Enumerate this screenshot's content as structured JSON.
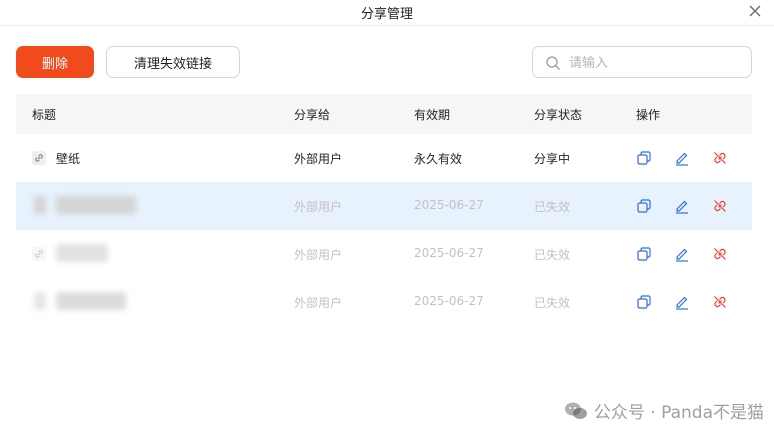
{
  "dialog": {
    "title": "分享管理"
  },
  "toolbar": {
    "delete_label": "删除",
    "clean_label": "清理失效链接"
  },
  "search": {
    "placeholder": "请输入"
  },
  "columns": [
    "标题",
    "分享给",
    "有效期",
    "分享状态",
    "操作"
  ],
  "rows": [
    {
      "title": "壁纸",
      "share_to": "外部用户",
      "expiry": "永久有效",
      "status": "分享中",
      "state": "active",
      "selected": false
    },
    {
      "title": "",
      "share_to": "外部用户",
      "expiry": "2025-06-27",
      "status": "已失效",
      "state": "expired",
      "selected": true
    },
    {
      "title": "",
      "share_to": "外部用户",
      "expiry": "2025-06-27",
      "status": "已失效",
      "state": "expired",
      "selected": false
    },
    {
      "title": "",
      "share_to": "外部用户",
      "expiry": "2025-06-27",
      "status": "已失效",
      "state": "expired",
      "selected": false
    }
  ],
  "watermark": "公众号 · Panda不是猫",
  "colors": {
    "primary_danger": "#f04a1d",
    "action_blue": "#2f6fd6",
    "action_red": "#e0432d",
    "selected_row": "#e8f1fe"
  },
  "icons": {
    "close": "close-icon",
    "search": "search-icon",
    "link": "link-icon",
    "copy": "copy-icon",
    "edit": "edit-icon",
    "unlink": "unlink-icon"
  }
}
